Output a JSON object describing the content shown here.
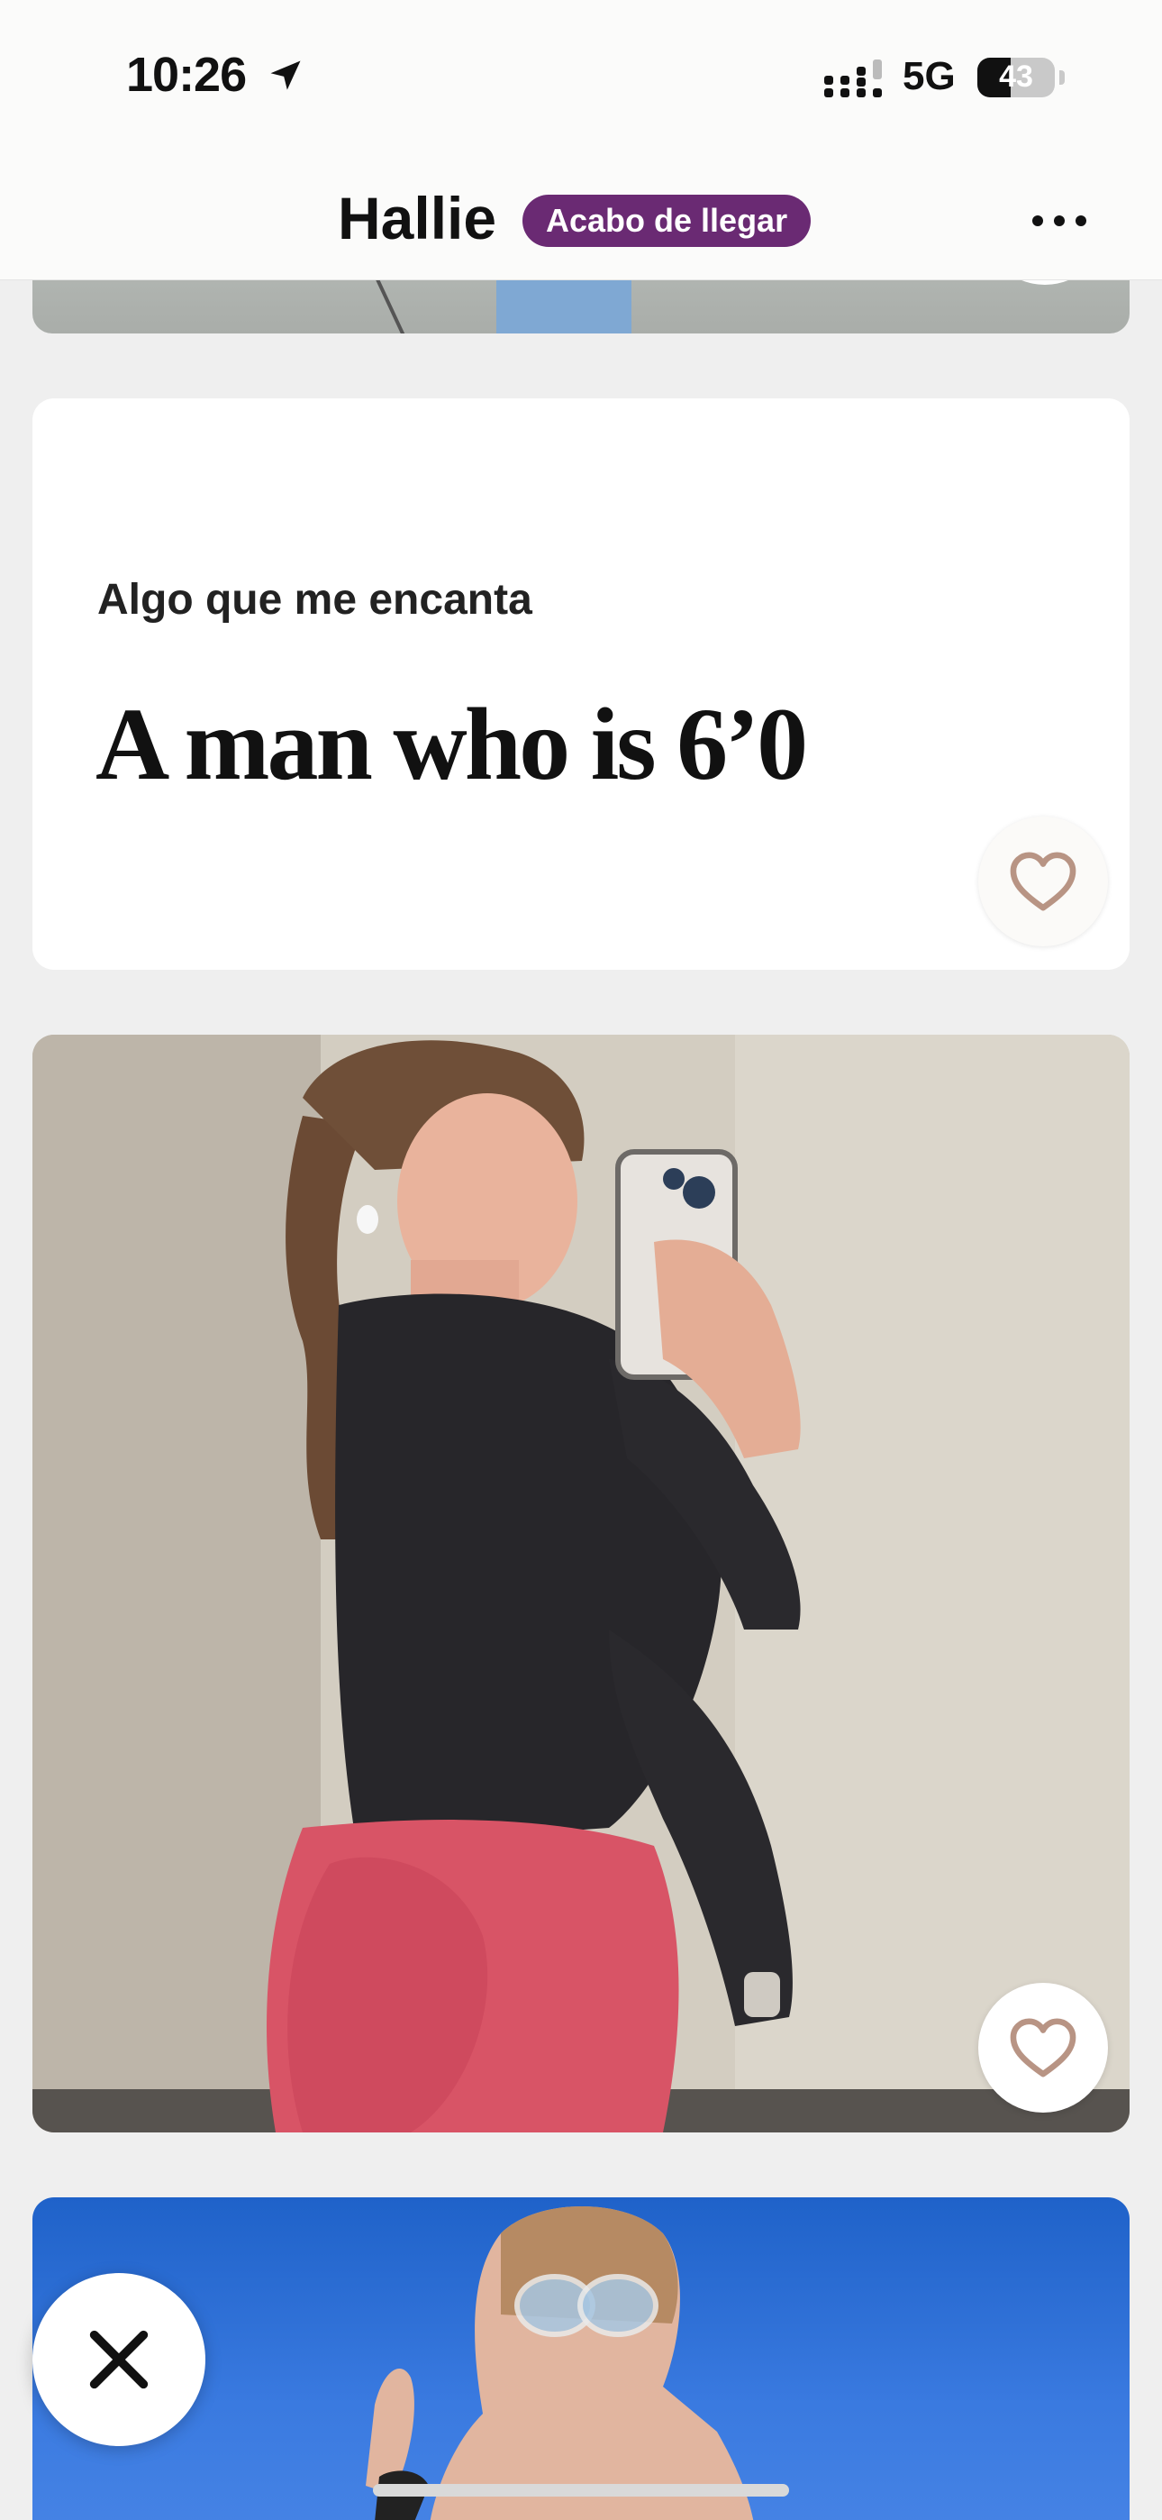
{
  "status_bar": {
    "time": "10:26",
    "network": "5G",
    "battery": "43",
    "battery_level": 0.43
  },
  "header": {
    "name": "Hallie",
    "badge": "Acabo de llegar"
  },
  "prompt": {
    "question": "Algo que me encanta",
    "answer": "A man who is 6’0"
  },
  "icons": {
    "location": "location-arrow-icon",
    "signal": "signal-bars-icon",
    "more": "ellipsis-icon",
    "like": "heart-icon",
    "skip": "close-icon"
  },
  "colors": {
    "badge": "#6a2a73",
    "heart_stroke": "#b89484",
    "next_photo_sky": "#2f6fd8"
  }
}
